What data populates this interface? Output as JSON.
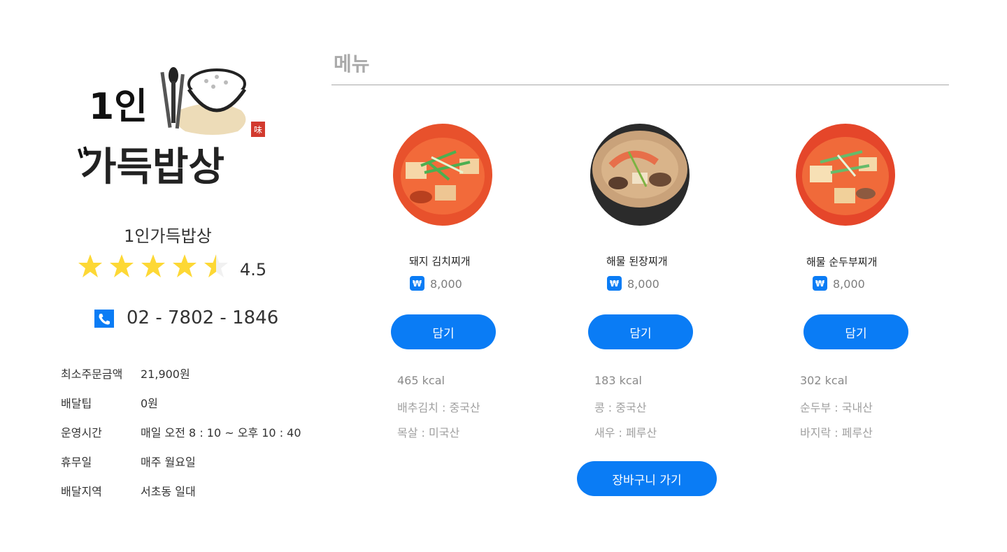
{
  "store": {
    "logo_text_1": "1인",
    "logo_text_2": "가득밥상",
    "logo_seal": "味",
    "name": "1인가득밥상",
    "rating": "4.5",
    "rating_value": 4.5,
    "rating_max": 5,
    "phone": "02 - 7802 - 1846",
    "info": [
      {
        "label": "최소주문금액",
        "value": "21,900원"
      },
      {
        "label": "배달팁",
        "value": "0원"
      },
      {
        "label": "운영시간",
        "value": "매일 오전 8 : 10 ~ 오후 10 : 40"
      },
      {
        "label": "휴무일",
        "value": "매주 월요일"
      },
      {
        "label": "배달지역",
        "value": "서초동 일대"
      }
    ]
  },
  "menu": {
    "title": "메뉴",
    "currency_symbol": "₩",
    "add_label": "담기",
    "items": [
      {
        "name": "돼지 김치찌개",
        "price": "8,000",
        "kcal": "465 kcal",
        "origins": [
          "배추김치 : 중국산",
          "목살 : 미국산"
        ]
      },
      {
        "name": "해물 된장찌개",
        "price": "8,000",
        "kcal": "183 kcal",
        "origins": [
          "콩 : 중국산",
          "새우 : 페루산"
        ]
      },
      {
        "name": "해물 순두부찌개",
        "price": "8,000",
        "kcal": "302 kcal",
        "origins": [
          "순두부 : 국내산",
          "바지락 : 페루산"
        ]
      }
    ],
    "cart_label": "장바구니 가기"
  },
  "colors": {
    "accent": "#0a7cf5",
    "star": "#fdd835",
    "muted_text": "#8a8a8a",
    "title_gray": "#aaaaaa"
  }
}
